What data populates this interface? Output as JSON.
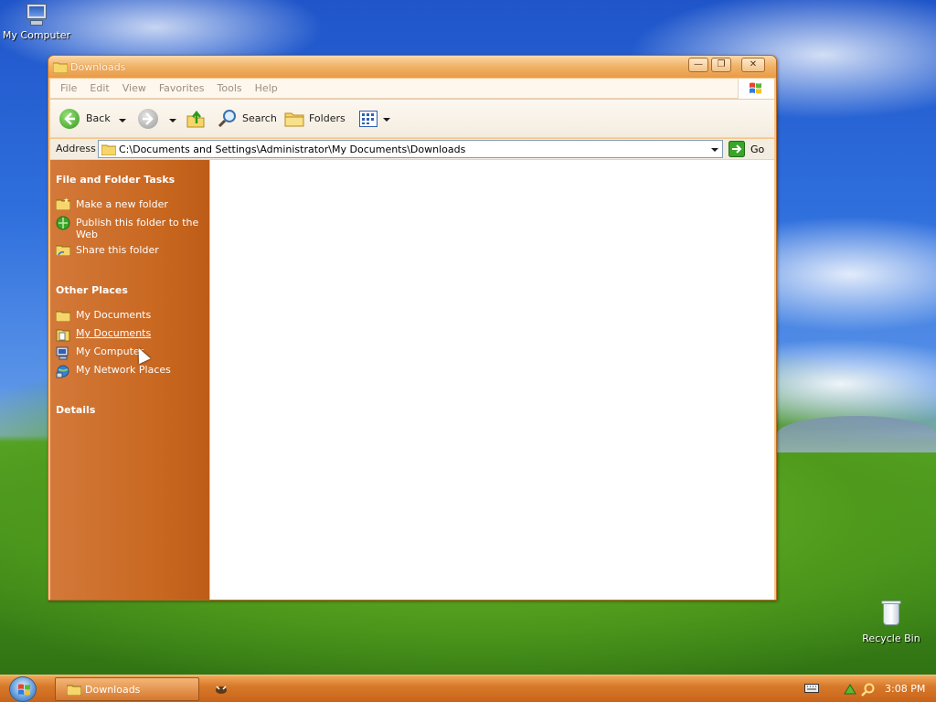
{
  "desktop": {
    "icons": [
      {
        "label": "My Computer"
      },
      {
        "label": "Recycle Bin"
      }
    ]
  },
  "window": {
    "title": "Downloads",
    "menu": [
      "File",
      "Edit",
      "View",
      "Favorites",
      "Tools",
      "Help"
    ],
    "toolbar": {
      "back_label": "Back",
      "search_label": "Search",
      "folders_label": "Folders"
    },
    "address": {
      "label": "Address",
      "value": "C:\\Documents and Settings\\Administrator\\My Documents\\Downloads",
      "go_label": "Go"
    },
    "taskpane": {
      "file_tasks_heading": "File and Folder Tasks",
      "file_tasks": [
        "Make a new folder",
        "Publish this folder to the Web",
        "Share this folder"
      ],
      "other_places_heading": "Other Places",
      "other_places": [
        "My Documents",
        "My Documents",
        "My Computer",
        "My Network Places"
      ],
      "details_heading": "Details"
    }
  },
  "taskbar": {
    "task_label": "Downloads",
    "time": "3:08 PM"
  },
  "colors": {
    "taskpane": "#c8671f",
    "titlebar": "#e99a45",
    "taskbar": "#d8792a"
  }
}
